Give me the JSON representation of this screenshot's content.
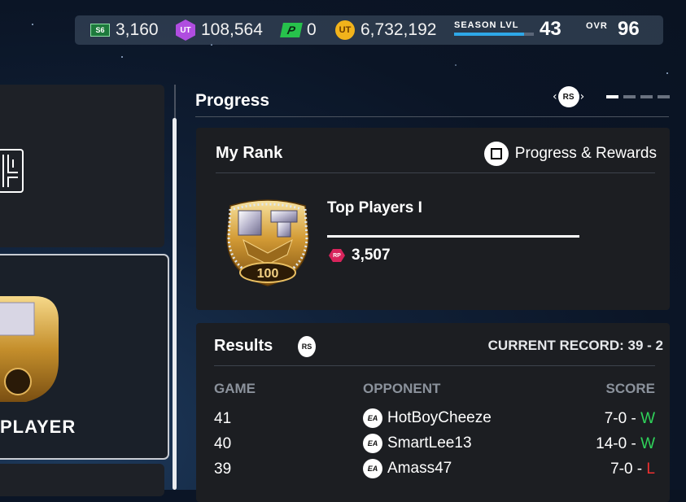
{
  "currencies": {
    "season_icon": "S6",
    "season_tokens": "3,160",
    "ut_hex_icon": "UT",
    "training": "108,564",
    "p_icon": "P",
    "points": "0",
    "coin_icon": "UT",
    "coins": "6,732,192"
  },
  "season": {
    "label": "SEASON LVL",
    "level": "43",
    "progress": 0.88
  },
  "ovr": {
    "label": "OVR",
    "value": "96"
  },
  "left": {
    "player_label": "PLAYER"
  },
  "progress": {
    "title": "Progress",
    "nav_button": "RS",
    "page_indicator": {
      "total": 4,
      "active": 1
    }
  },
  "rank": {
    "title": "My Rank",
    "link_label": "Progress & Rewards",
    "badge_text": "100",
    "name": "Top Players I",
    "rp_icon": "RP",
    "rp_value": "3,507"
  },
  "results": {
    "title": "Results",
    "rs_icon": "RS",
    "record": "CURRENT RECORD: 39 - 2",
    "columns": {
      "game": "GAME",
      "opponent": "OPPONENT",
      "score": "SCORE"
    },
    "ea_icon": "EA",
    "rows": [
      {
        "game": "41",
        "opponent": "HotBoyCheeze",
        "score": "7-0 - ",
        "result": "W"
      },
      {
        "game": "40",
        "opponent": "SmartLee13",
        "score": "14-0 - ",
        "result": "W"
      },
      {
        "game": "39",
        "opponent": "Amass47",
        "score": "7-0 - ",
        "result": "L"
      }
    ]
  },
  "colors": {
    "win": "#2fd35a",
    "loss": "#f03030",
    "accent": "#2ea7e8",
    "coin": "#f2b31b",
    "rp": "#d8245c"
  }
}
